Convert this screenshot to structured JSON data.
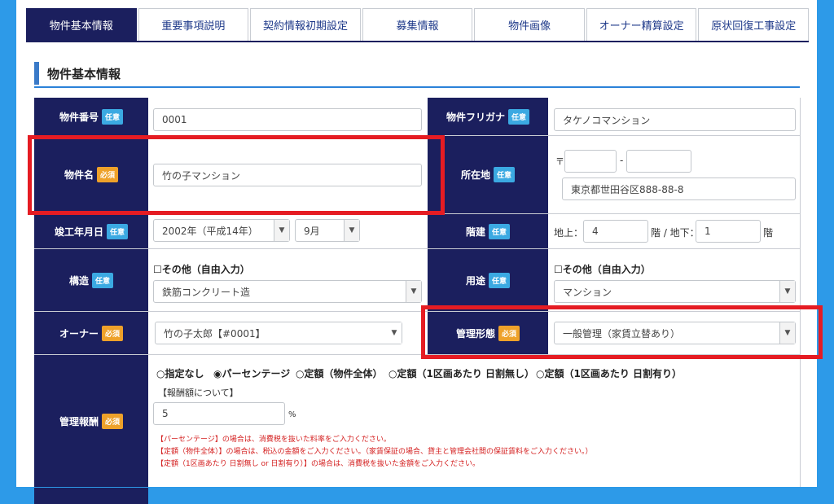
{
  "tabs": [
    "物件基本情報",
    "重要事項説明",
    "契約情報初期設定",
    "募集情報",
    "物件画像",
    "オーナー精算設定",
    "原状回復工事設定"
  ],
  "section_title": "物件基本情報",
  "badges": {
    "optional": "任意",
    "required": "必須"
  },
  "fields": {
    "property_number": {
      "label": "物件番号",
      "value": "0001"
    },
    "property_kana": {
      "label": "物件フリガナ",
      "value": "タケノコマンション"
    },
    "property_name": {
      "label": "物件名",
      "value": "竹の子マンション"
    },
    "address": {
      "label": "所在地",
      "postal_prefix": "〒",
      "postal_sep": "-",
      "value": "東京都世田谷区888-88-8"
    },
    "completion": {
      "label": "竣工年月日",
      "year": "2002年（平成14年）",
      "month": "9月"
    },
    "floors": {
      "label": "階建",
      "above_label": "地上：",
      "above": "4",
      "below_label": "階 / 地下：",
      "below": "1",
      "suffix": "階"
    },
    "structure": {
      "label": "構造",
      "checkbox": "☐その他（自由入力）",
      "value": "鉄筋コンクリート造"
    },
    "usage": {
      "label": "用途",
      "checkbox": "☐その他（自由入力）",
      "value": "マンション"
    },
    "owner": {
      "label": "オーナー",
      "value": "竹の子太郎【#0001】"
    },
    "management_type": {
      "label": "管理形態",
      "value": "一般管理（家賃立替あり）"
    },
    "management_fee": {
      "label": "管理報酬",
      "options": [
        "○指定なし",
        "◉パーセンテージ",
        "○定額（物件全体）",
        "○定額（1区画あたり 日割無し）",
        "○定額（1区画あたり 日割有り）"
      ],
      "sub_label": "【報酬額について】",
      "value": "5",
      "unit": "%",
      "notes": [
        "【パーセンテージ】の場合は、消費税を抜いた料率をご入力ください。",
        "【定額（物件全体）】の場合は、税込の金額をご入力ください。（家賃保証の場合、貸主と管理会社間の保証賃料をご入力ください。）",
        "【定額（1区画あたり 日割無し or 日割有り）】の場合は、消費税を抜いた金額をご入力ください。"
      ]
    }
  },
  "colors": {
    "header": "#1b1f5e",
    "accent": "#2b82d9",
    "highlight": "#e51c23",
    "page_bg": "#2d9ae8"
  }
}
